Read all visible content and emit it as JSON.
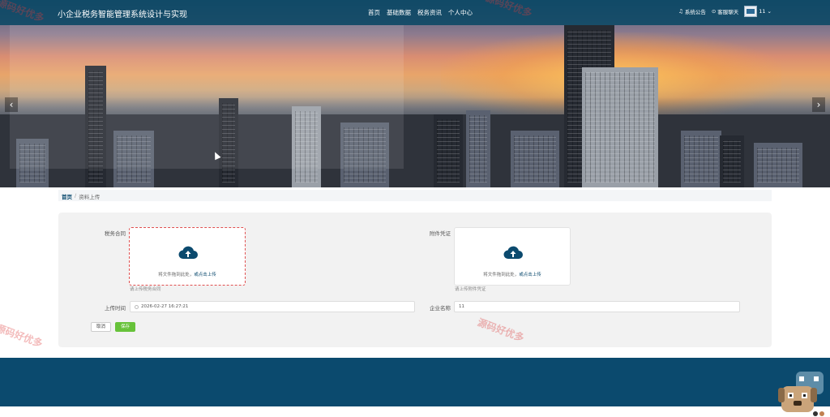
{
  "header": {
    "site_title": "小企业税务智能管理系统设计与实现",
    "nav": [
      "首页",
      "基础数据",
      "税务资讯",
      "个人中心"
    ],
    "notice_label": "系统公告",
    "chat_label": "客服聊天",
    "username": "11"
  },
  "breadcrumb": {
    "home": "首页",
    "separator": "/",
    "current": "资料上传"
  },
  "form": {
    "contract_label": "税务合同",
    "contract_upload_hint": "将文件拖到此处，",
    "contract_upload_link": "或点击上传",
    "contract_tip": "请上传税务合同",
    "voucher_label": "附件凭证",
    "voucher_upload_hint": "将文件拖到此处，",
    "voucher_upload_link": "或点击上传",
    "voucher_tip": "请上传附件凭证",
    "upload_time_label": "上传时间",
    "upload_time_value": "2026-02-27 16:27:21",
    "company_label": "企业名称",
    "company_value": "11",
    "cancel_label": "取消",
    "save_label": "保存"
  },
  "watermark": "源码好优多",
  "colors": {
    "primary": "#0b4a6e",
    "save": "#67c23a",
    "upload_active_border": "#e05050"
  }
}
